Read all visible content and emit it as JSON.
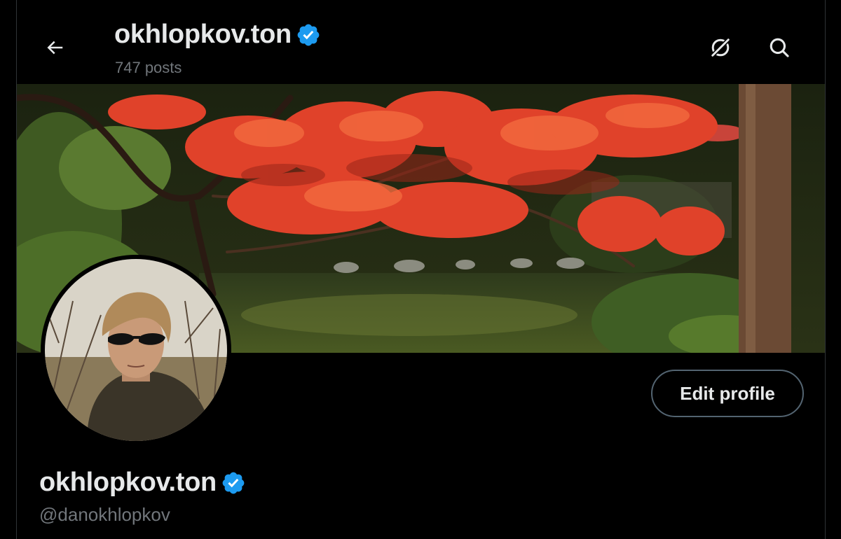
{
  "header": {
    "title": "okhlopkov.ton",
    "posts_count": "747 posts",
    "icons": {
      "back": "arrow-left-icon",
      "grok": "grok-icon",
      "search": "search-icon"
    }
  },
  "profile": {
    "display_name": "okhlopkov.ton",
    "handle": "@danokhlopkov",
    "verified": true,
    "edit_button_label": "Edit profile"
  },
  "colors": {
    "background": "#000000",
    "text_primary": "#e7e9ea",
    "text_secondary": "#71767b",
    "verified_blue": "#1d9bf0",
    "button_border": "#536471"
  }
}
